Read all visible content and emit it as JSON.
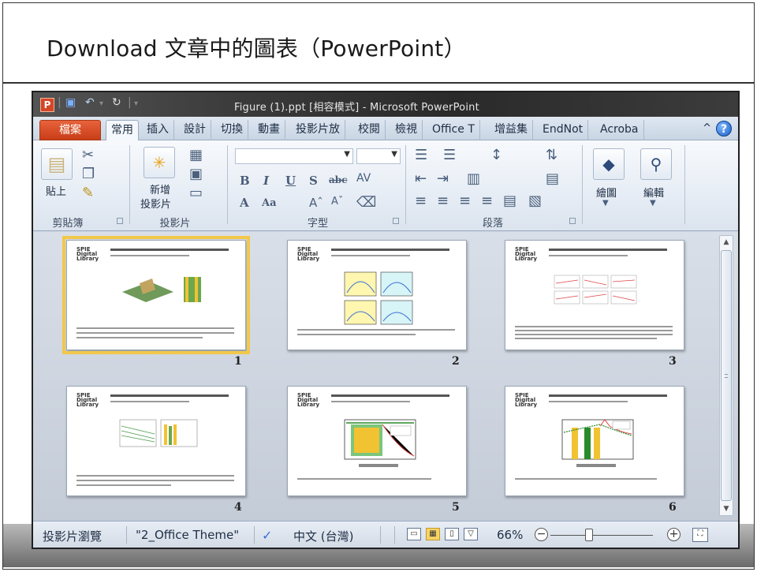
{
  "slide": {
    "title": "Download 文章中的圖表（PowerPoint）"
  },
  "window": {
    "title": "Figure (1).ppt [相容模式] - Microsoft PowerPoint",
    "logo_letter": "P"
  },
  "tabs": [
    "檔案",
    "常用",
    "插入",
    "設計",
    "切換",
    "動畫",
    "投影片放",
    "校閱",
    "檢視",
    "Office T",
    "增益集",
    "EndNot",
    "Acroba"
  ],
  "help_label": "?",
  "ribbon": {
    "clipboard": {
      "label": "剪貼簿",
      "paste": "貼上"
    },
    "slides": {
      "label": "投影片",
      "new_slide_1": "新增",
      "new_slide_2": "投影片"
    },
    "font": {
      "label": "字型",
      "bold": "B",
      "italic": "I",
      "underline": "U",
      "strike": "S",
      "abc": "abc",
      "grow": "A",
      "aa": "Aa"
    },
    "paragraph": {
      "label": "段落"
    },
    "drawing": {
      "label": "繪圖"
    },
    "editing": {
      "label": "編輯"
    }
  },
  "thumbnails": [
    {
      "number": "1",
      "selected": true
    },
    {
      "number": "2",
      "selected": false
    },
    {
      "number": "3",
      "selected": false
    },
    {
      "number": "4",
      "selected": false
    },
    {
      "number": "5",
      "selected": false
    },
    {
      "number": "6",
      "selected": false
    }
  ],
  "thumbnail_logo": [
    "SPIE",
    "Digital",
    "Library"
  ],
  "status": {
    "view_mode": "投影片瀏覽",
    "theme": "\"2_Office Theme\"",
    "language": "中文 (台灣)",
    "zoom": "66%",
    "zoom_minus": "−",
    "zoom_plus": "+"
  }
}
